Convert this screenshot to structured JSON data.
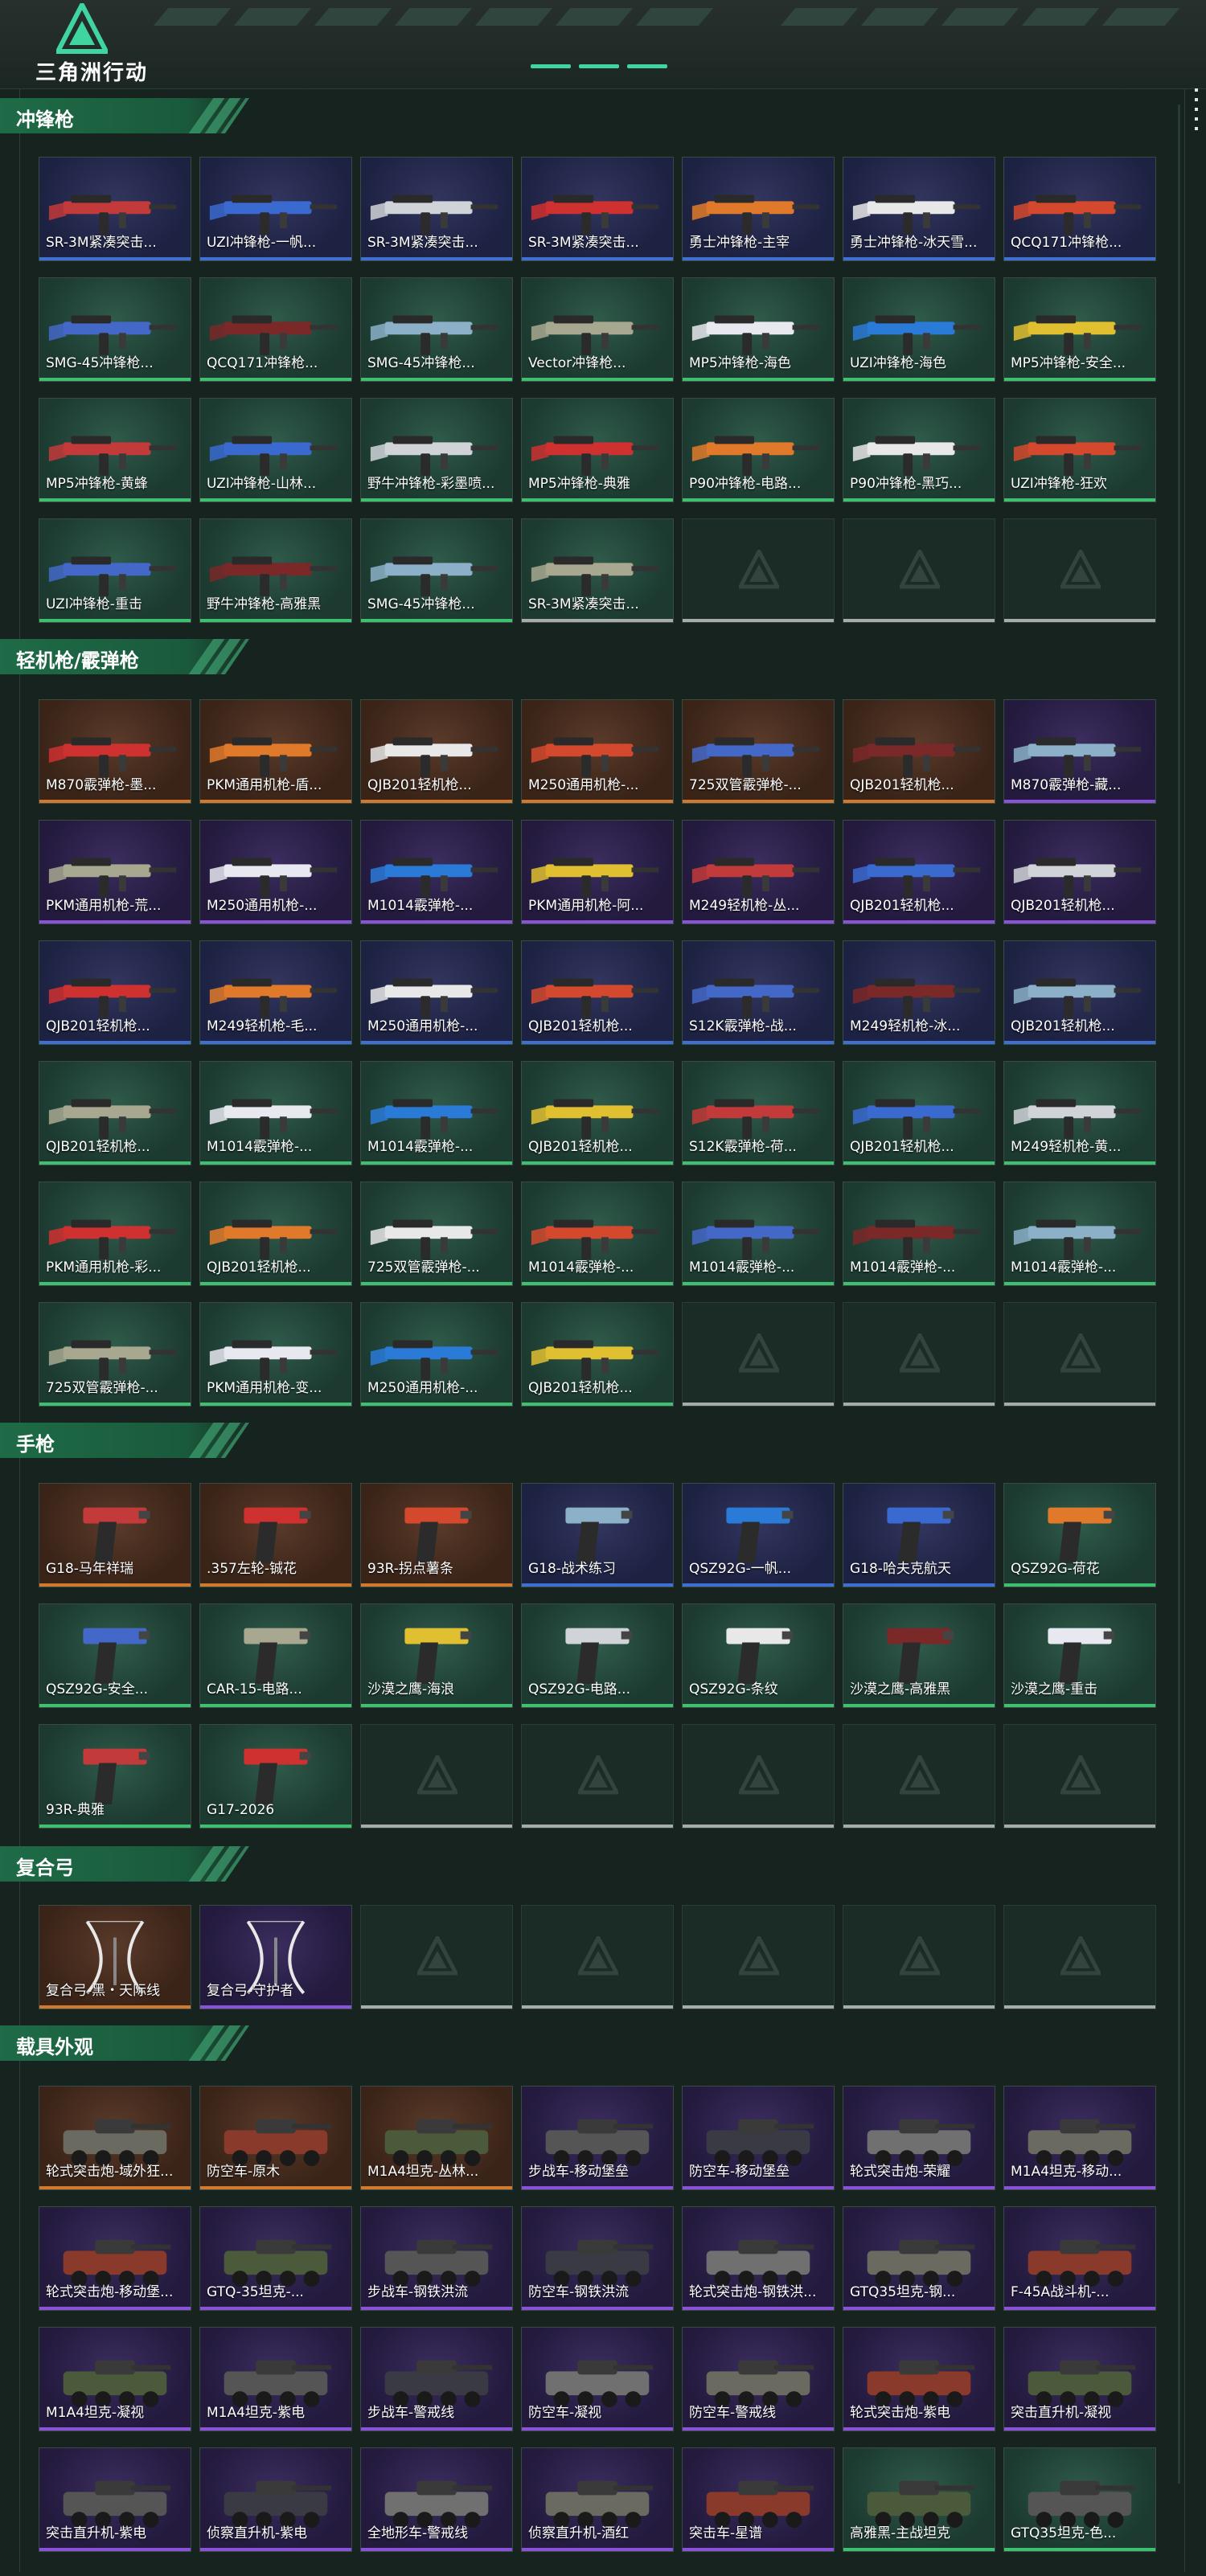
{
  "app": {
    "logo_text": "三角洲行动"
  },
  "sections": [
    {
      "key": "smg",
      "title": "冲锋枪",
      "items": [
        {
          "name": "SR-3M紧凑突击...",
          "rarity": "blue",
          "kind": "gun"
        },
        {
          "name": "UZI冲锋枪-一帆...",
          "rarity": "blue",
          "kind": "gun"
        },
        {
          "name": "SR-3M紧凑突击...",
          "rarity": "blue",
          "kind": "gun"
        },
        {
          "name": "SR-3M紧凑突击...",
          "rarity": "blue",
          "kind": "gun"
        },
        {
          "name": "勇士冲锋枪-主宰",
          "rarity": "blue",
          "kind": "gun"
        },
        {
          "name": "勇士冲锋枪-冰天雪...",
          "rarity": "blue",
          "kind": "gun"
        },
        {
          "name": "QCQ171冲锋枪...",
          "rarity": "blue",
          "kind": "gun"
        },
        {
          "name": "SMG-45冲锋枪...",
          "rarity": "green",
          "kind": "gun"
        },
        {
          "name": "QCQ171冲锋枪...",
          "rarity": "green",
          "kind": "gun"
        },
        {
          "name": "SMG-45冲锋枪...",
          "rarity": "green",
          "kind": "gun"
        },
        {
          "name": "Vector冲锋枪...",
          "rarity": "green",
          "kind": "gun"
        },
        {
          "name": "MP5冲锋枪-海色",
          "rarity": "green",
          "kind": "gun"
        },
        {
          "name": "UZI冲锋枪-海色",
          "rarity": "green",
          "kind": "gun"
        },
        {
          "name": "MP5冲锋枪-安全...",
          "rarity": "green",
          "kind": "gun"
        },
        {
          "name": "MP5冲锋枪-黄蜂",
          "rarity": "green",
          "kind": "gun"
        },
        {
          "name": "UZI冲锋枪-山林...",
          "rarity": "green",
          "kind": "gun"
        },
        {
          "name": "野牛冲锋枪-彩墨喷...",
          "rarity": "green",
          "kind": "gun"
        },
        {
          "name": "MP5冲锋枪-典雅",
          "rarity": "green",
          "kind": "gun"
        },
        {
          "name": "P90冲锋枪-电路...",
          "rarity": "green",
          "kind": "gun"
        },
        {
          "name": "P90冲锋枪-黑巧...",
          "rarity": "green",
          "kind": "gun"
        },
        {
          "name": "UZI冲锋枪-狂欢",
          "rarity": "green",
          "kind": "gun"
        },
        {
          "name": "UZI冲锋枪-重击",
          "rarity": "green",
          "kind": "gun"
        },
        {
          "name": "野牛冲锋枪-高雅黑",
          "rarity": "green",
          "kind": "gun"
        },
        {
          "name": "SMG-45冲锋枪...",
          "rarity": "green",
          "kind": "gun"
        },
        {
          "name": "SR-3M紧凑突击...",
          "rarity": "gray",
          "kind": "gun"
        },
        {
          "name": "",
          "rarity": "empty"
        },
        {
          "name": "",
          "rarity": "empty"
        },
        {
          "name": "",
          "rarity": "empty"
        }
      ]
    },
    {
      "key": "lmg",
      "title": "轻机枪/霰弹枪",
      "items": [
        {
          "name": "M870霰弹枪-墨...",
          "rarity": "orange",
          "kind": "gun"
        },
        {
          "name": "PKM通用机枪-盾...",
          "rarity": "orange",
          "kind": "gun"
        },
        {
          "name": "QJB201轻机枪...",
          "rarity": "orange",
          "kind": "gun"
        },
        {
          "name": "M250通用机枪-...",
          "rarity": "orange",
          "kind": "gun"
        },
        {
          "name": "725双管霰弹枪-...",
          "rarity": "orange",
          "kind": "gun"
        },
        {
          "name": "QJB201轻机枪...",
          "rarity": "orange",
          "kind": "gun"
        },
        {
          "name": "M870霰弹枪-藏...",
          "rarity": "purple",
          "kind": "gun"
        },
        {
          "name": "PKM通用机枪-荒...",
          "rarity": "purple",
          "kind": "gun"
        },
        {
          "name": "M250通用机枪-...",
          "rarity": "purple",
          "kind": "gun"
        },
        {
          "name": "M1014霰弹枪-...",
          "rarity": "purple",
          "kind": "gun"
        },
        {
          "name": "PKM通用机枪-阿...",
          "rarity": "purple",
          "kind": "gun"
        },
        {
          "name": "M249轻机枪-丛...",
          "rarity": "purple",
          "kind": "gun"
        },
        {
          "name": "QJB201轻机枪...",
          "rarity": "purple",
          "kind": "gun"
        },
        {
          "name": "QJB201轻机枪...",
          "rarity": "purple",
          "kind": "gun"
        },
        {
          "name": "QJB201轻机枪...",
          "rarity": "blue",
          "kind": "gun"
        },
        {
          "name": "M249轻机枪-毛...",
          "rarity": "blue",
          "kind": "gun"
        },
        {
          "name": "M250通用机枪-...",
          "rarity": "blue",
          "kind": "gun"
        },
        {
          "name": "QJB201轻机枪...",
          "rarity": "blue",
          "kind": "gun"
        },
        {
          "name": "S12K霰弹枪-战...",
          "rarity": "blue",
          "kind": "gun"
        },
        {
          "name": "M249轻机枪-冰...",
          "rarity": "blue",
          "kind": "gun"
        },
        {
          "name": "QJB201轻机枪...",
          "rarity": "blue",
          "kind": "gun"
        },
        {
          "name": "QJB201轻机枪...",
          "rarity": "green",
          "kind": "gun"
        },
        {
          "name": "M1014霰弹枪-...",
          "rarity": "green",
          "kind": "gun"
        },
        {
          "name": "M1014霰弹枪-...",
          "rarity": "green",
          "kind": "gun"
        },
        {
          "name": "QJB201轻机枪...",
          "rarity": "green",
          "kind": "gun"
        },
        {
          "name": "S12K霰弹枪-荷...",
          "rarity": "green",
          "kind": "gun"
        },
        {
          "name": "QJB201轻机枪...",
          "rarity": "green",
          "kind": "gun"
        },
        {
          "name": "M249轻机枪-黄...",
          "rarity": "green",
          "kind": "gun"
        },
        {
          "name": "PKM通用机枪-彩...",
          "rarity": "green",
          "kind": "gun"
        },
        {
          "name": "QJB201轻机枪...",
          "rarity": "green",
          "kind": "gun"
        },
        {
          "name": "725双管霰弹枪-...",
          "rarity": "green",
          "kind": "gun"
        },
        {
          "name": "M1014霰弹枪-...",
          "rarity": "green",
          "kind": "gun"
        },
        {
          "name": "M1014霰弹枪-...",
          "rarity": "green",
          "kind": "gun"
        },
        {
          "name": "M1014霰弹枪-...",
          "rarity": "green",
          "kind": "gun"
        },
        {
          "name": "M1014霰弹枪-...",
          "rarity": "green",
          "kind": "gun"
        },
        {
          "name": "725双管霰弹枪-...",
          "rarity": "green",
          "kind": "gun"
        },
        {
          "name": "PKM通用机枪-变...",
          "rarity": "green",
          "kind": "gun"
        },
        {
          "name": "M250通用机枪-...",
          "rarity": "green",
          "kind": "gun"
        },
        {
          "name": "QJB201轻机枪...",
          "rarity": "green",
          "kind": "gun"
        },
        {
          "name": "",
          "rarity": "empty"
        },
        {
          "name": "",
          "rarity": "empty"
        },
        {
          "name": "",
          "rarity": "empty"
        }
      ]
    },
    {
      "key": "pistol",
      "title": "手枪",
      "items": [
        {
          "name": "G18-马年祥瑞",
          "rarity": "orange",
          "kind": "pistol"
        },
        {
          "name": ".357左轮-铖花",
          "rarity": "orange",
          "kind": "pistol"
        },
        {
          "name": "93R-拐点薯条",
          "rarity": "orange",
          "kind": "pistol"
        },
        {
          "name": "G18-战术练习",
          "rarity": "blue",
          "kind": "pistol"
        },
        {
          "name": "QSZ92G-一帆...",
          "rarity": "blue",
          "kind": "pistol"
        },
        {
          "name": "G18-哈夫克航天",
          "rarity": "blue",
          "kind": "pistol"
        },
        {
          "name": "QSZ92G-荷花",
          "rarity": "green",
          "kind": "pistol"
        },
        {
          "name": "QSZ92G-安全...",
          "rarity": "green",
          "kind": "pistol"
        },
        {
          "name": "CAR-15-电路...",
          "rarity": "green",
          "kind": "pistol"
        },
        {
          "name": "沙漠之鹰-海浪",
          "rarity": "green",
          "kind": "pistol"
        },
        {
          "name": "QSZ92G-电路...",
          "rarity": "green",
          "kind": "pistol"
        },
        {
          "name": "QSZ92G-条纹",
          "rarity": "green",
          "kind": "pistol"
        },
        {
          "name": "沙漠之鹰-高雅黑",
          "rarity": "green",
          "kind": "pistol"
        },
        {
          "name": "沙漠之鹰-重击",
          "rarity": "green",
          "kind": "pistol"
        },
        {
          "name": "93R-典雅",
          "rarity": "green",
          "kind": "pistol"
        },
        {
          "name": "G17-2026",
          "rarity": "green",
          "kind": "pistol"
        },
        {
          "name": "",
          "rarity": "empty"
        },
        {
          "name": "",
          "rarity": "empty"
        },
        {
          "name": "",
          "rarity": "empty"
        },
        {
          "name": "",
          "rarity": "empty"
        },
        {
          "name": "",
          "rarity": "empty"
        }
      ]
    },
    {
      "key": "bow",
      "title": "复合弓",
      "items": [
        {
          "name": "复合弓-黑・天际线",
          "rarity": "orange",
          "kind": "bow"
        },
        {
          "name": "复合弓-守护者",
          "rarity": "purple",
          "kind": "bow"
        },
        {
          "name": "",
          "rarity": "empty"
        },
        {
          "name": "",
          "rarity": "empty"
        },
        {
          "name": "",
          "rarity": "empty"
        },
        {
          "name": "",
          "rarity": "empty"
        },
        {
          "name": "",
          "rarity": "empty"
        }
      ]
    },
    {
      "key": "vehicle",
      "title": "载具外观",
      "items": [
        {
          "name": "轮式突击炮-域外狂...",
          "rarity": "orange",
          "kind": "vehicle"
        },
        {
          "name": "防空车-原木",
          "rarity": "orange",
          "kind": "vehicle"
        },
        {
          "name": "M1A4坦克-丛林...",
          "rarity": "orange",
          "kind": "vehicle"
        },
        {
          "name": "步战车-移动堡垒",
          "rarity": "purple",
          "kind": "vehicle"
        },
        {
          "name": "防空车-移动堡垒",
          "rarity": "purple",
          "kind": "vehicle"
        },
        {
          "name": "轮式突击炮-荣耀",
          "rarity": "purple",
          "kind": "vehicle"
        },
        {
          "name": "M1A4坦克-移动...",
          "rarity": "purple",
          "kind": "vehicle"
        },
        {
          "name": "轮式突击炮-移动堡...",
          "rarity": "purple",
          "kind": "vehicle"
        },
        {
          "name": "GTQ-35坦克-...",
          "rarity": "purple",
          "kind": "vehicle"
        },
        {
          "name": "步战车-钢铁洪流",
          "rarity": "purple",
          "kind": "vehicle"
        },
        {
          "name": "防空车-钢铁洪流",
          "rarity": "purple",
          "kind": "vehicle"
        },
        {
          "name": "轮式突击炮-钢铁洪...",
          "rarity": "purple",
          "kind": "vehicle"
        },
        {
          "name": "GTQ35坦克-钢...",
          "rarity": "purple",
          "kind": "vehicle"
        },
        {
          "name": "F-45A战斗机-...",
          "rarity": "purple",
          "kind": "vehicle"
        },
        {
          "name": "M1A4坦克-凝视",
          "rarity": "purple",
          "kind": "vehicle"
        },
        {
          "name": "M1A4坦克-紫电",
          "rarity": "purple",
          "kind": "vehicle"
        },
        {
          "name": "步战车-警戒线",
          "rarity": "purple",
          "kind": "vehicle"
        },
        {
          "name": "防空车-凝视",
          "rarity": "purple",
          "kind": "vehicle"
        },
        {
          "name": "防空车-警戒线",
          "rarity": "purple",
          "kind": "vehicle"
        },
        {
          "name": "轮式突击炮-紫电",
          "rarity": "purple",
          "kind": "vehicle"
        },
        {
          "name": "突击直升机-凝视",
          "rarity": "purple",
          "kind": "vehicle"
        },
        {
          "name": "突击直升机-紫电",
          "rarity": "purple",
          "kind": "vehicle"
        },
        {
          "name": "侦察直升机-紫电",
          "rarity": "purple",
          "kind": "vehicle"
        },
        {
          "name": "全地形车-警戒线",
          "rarity": "purple",
          "kind": "vehicle"
        },
        {
          "name": "侦察直升机-酒红",
          "rarity": "purple",
          "kind": "vehicle"
        },
        {
          "name": "突击车-星谱",
          "rarity": "purple",
          "kind": "vehicle"
        },
        {
          "name": "高雅黑-主战坦克",
          "rarity": "green",
          "kind": "vehicle"
        },
        {
          "name": "GTQ35坦克-色...",
          "rarity": "green",
          "kind": "vehicle"
        }
      ]
    }
  ]
}
